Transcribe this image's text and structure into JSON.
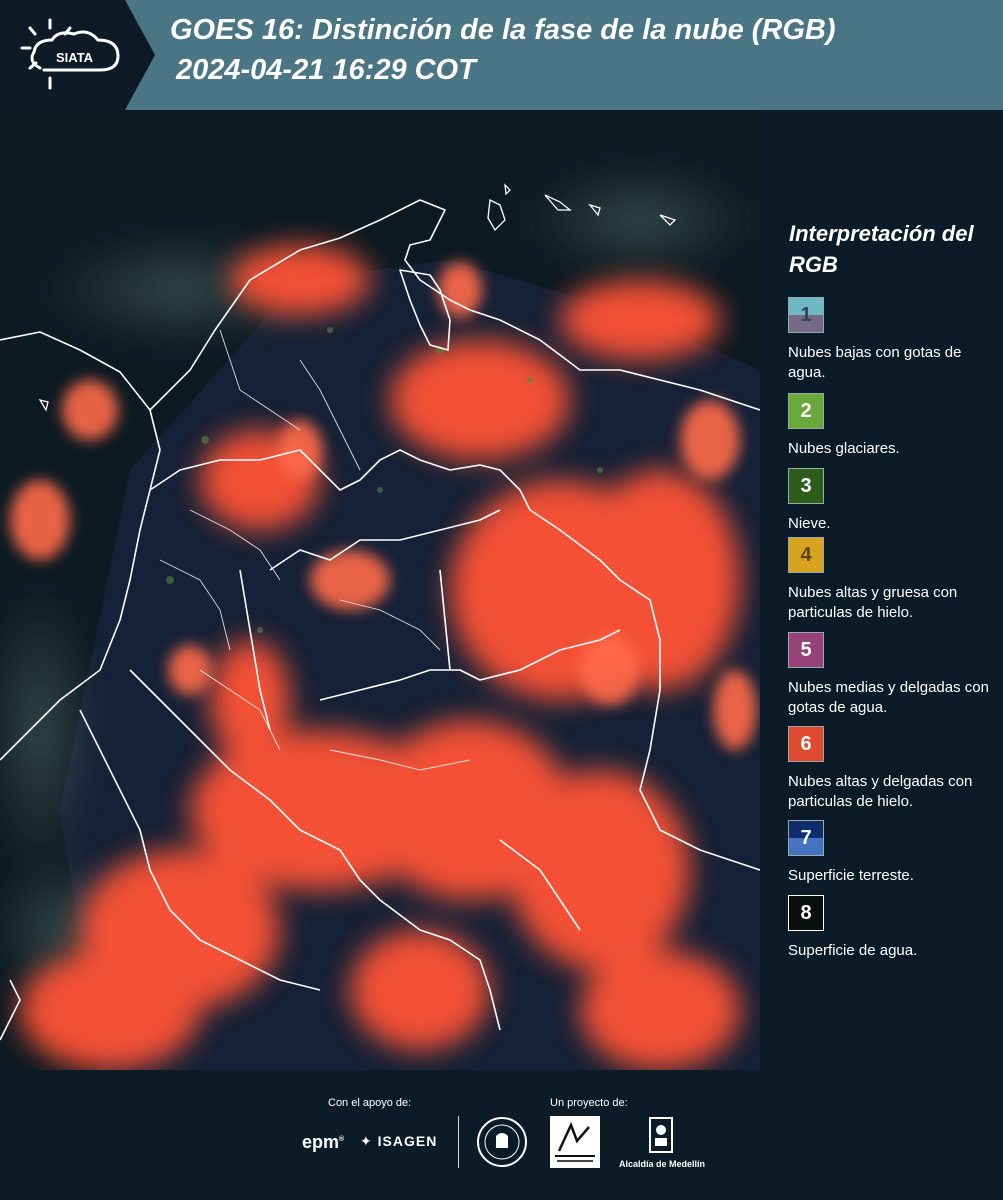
{
  "header": {
    "logo_text": "SIATA",
    "title_line1": "GOES 16: Distinción de la fase de la nube (RGB)",
    "title_line2": "2024-04-21 16:29 COT"
  },
  "legend": {
    "title": "Interpretación del RGB",
    "items": [
      {
        "number": "1",
        "label": "Nubes bajas con gotas de agua.",
        "colors": [
          "#6fb9c5",
          "#756a85"
        ]
      },
      {
        "number": "2",
        "label": "Nubes glaciares.",
        "colors": [
          "#6aa83a"
        ]
      },
      {
        "number": "3",
        "label": "Nieve.",
        "colors": [
          "#2d5d1a"
        ]
      },
      {
        "number": "4",
        "label": "Nubes altas y gruesa con particulas de hielo.",
        "colors": [
          "#d9a320"
        ]
      },
      {
        "number": "5",
        "label": "Nubes medias y delgadas con gotas de agua.",
        "colors": [
          "#98427a"
        ]
      },
      {
        "number": "6",
        "label": "Nubes altas y delgadas con particulas de hielo.",
        "colors": [
          "#e04a30"
        ]
      },
      {
        "number": "7",
        "label": "Superficie terreste.",
        "colors": [
          "#0f2d6a",
          "#4573c4"
        ]
      },
      {
        "number": "8",
        "label": "Superficie de agua.",
        "colors": [
          "#0a0f0c"
        ]
      }
    ]
  },
  "footer": {
    "support_caption": "Con el apoyo de:",
    "project_caption": "Un proyecto de:",
    "epm": "epm",
    "isagen": "ISAGEN",
    "alcaldia": "Alcaldía de Medellín"
  },
  "colors": {
    "header_bg": "#4a7585",
    "panel_bg": "#0b1c28",
    "cloud_red": "#ff5a3c",
    "land_dark": "#16233a"
  }
}
